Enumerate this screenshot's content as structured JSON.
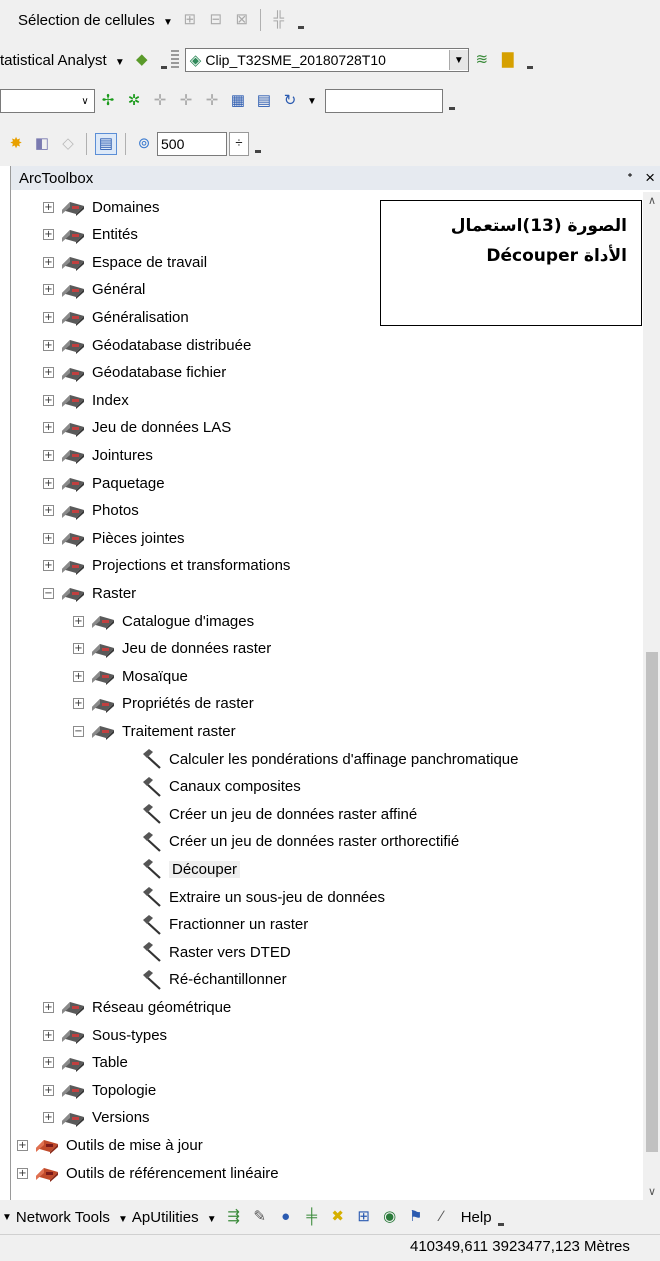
{
  "toolbars": {
    "row1": {
      "label": "Sélection de cellules"
    },
    "row2": {
      "label": "tatistical Analyst",
      "layer_combo": "Clip_T32SME_20180728T10"
    },
    "row4": {
      "scale_value": "500"
    }
  },
  "panel": {
    "title": "ArcToolbox",
    "pin": "ᐩ",
    "close": "×"
  },
  "tree": [
    {
      "label": "Domaines",
      "level": 2,
      "kind": "toolbox",
      "state": "collapsed"
    },
    {
      "label": "Entités",
      "level": 2,
      "kind": "toolbox",
      "state": "collapsed"
    },
    {
      "label": "Espace de travail",
      "level": 2,
      "kind": "toolbox",
      "state": "collapsed"
    },
    {
      "label": "Général",
      "level": 2,
      "kind": "toolbox",
      "state": "collapsed"
    },
    {
      "label": "Généralisation",
      "level": 2,
      "kind": "toolbox",
      "state": "collapsed"
    },
    {
      "label": "Géodatabase distribuée",
      "level": 2,
      "kind": "toolbox",
      "state": "collapsed"
    },
    {
      "label": "Géodatabase fichier",
      "level": 2,
      "kind": "toolbox",
      "state": "collapsed"
    },
    {
      "label": "Index",
      "level": 2,
      "kind": "toolbox",
      "state": "collapsed"
    },
    {
      "label": "Jeu de données LAS",
      "level": 2,
      "kind": "toolbox",
      "state": "collapsed"
    },
    {
      "label": "Jointures",
      "level": 2,
      "kind": "toolbox",
      "state": "collapsed"
    },
    {
      "label": "Paquetage",
      "level": 2,
      "kind": "toolbox",
      "state": "collapsed"
    },
    {
      "label": "Photos",
      "level": 2,
      "kind": "toolbox",
      "state": "collapsed"
    },
    {
      "label": "Pièces jointes",
      "level": 2,
      "kind": "toolbox",
      "state": "collapsed"
    },
    {
      "label": "Projections et transformations",
      "level": 2,
      "kind": "toolbox",
      "state": "collapsed"
    },
    {
      "label": "Raster",
      "level": 2,
      "kind": "toolbox",
      "state": "expanded"
    },
    {
      "label": "Catalogue d'images",
      "level": 3,
      "kind": "toolbox",
      "state": "collapsed"
    },
    {
      "label": "Jeu de données raster",
      "level": 3,
      "kind": "toolbox",
      "state": "collapsed"
    },
    {
      "label": "Mosaïque",
      "level": 3,
      "kind": "toolbox",
      "state": "collapsed"
    },
    {
      "label": "Propriétés de raster",
      "level": 3,
      "kind": "toolbox",
      "state": "collapsed"
    },
    {
      "label": "Traitement raster",
      "level": 3,
      "kind": "toolbox",
      "state": "expanded"
    },
    {
      "label": "Calculer les pondérations d'affinage panchromatique",
      "level": 4,
      "kind": "tool"
    },
    {
      "label": "Canaux composites",
      "level": 4,
      "kind": "tool"
    },
    {
      "label": "Créer un jeu de données raster affiné",
      "level": 4,
      "kind": "tool"
    },
    {
      "label": "Créer un jeu de données raster orthorectifié",
      "level": 4,
      "kind": "tool"
    },
    {
      "label": "Découper",
      "level": 4,
      "kind": "tool",
      "highlighted": true
    },
    {
      "label": "Extraire un sous-jeu de données",
      "level": 4,
      "kind": "tool"
    },
    {
      "label": "Fractionner un raster",
      "level": 4,
      "kind": "tool"
    },
    {
      "label": "Raster vers DTED",
      "level": 4,
      "kind": "tool"
    },
    {
      "label": "Ré-échantillonner",
      "level": 4,
      "kind": "tool"
    },
    {
      "label": "Réseau géométrique",
      "level": 2,
      "kind": "toolbox",
      "state": "collapsed"
    },
    {
      "label": "Sous-types",
      "level": 2,
      "kind": "toolbox",
      "state": "collapsed"
    },
    {
      "label": "Table",
      "level": 2,
      "kind": "toolbox",
      "state": "collapsed"
    },
    {
      "label": "Topologie",
      "level": 2,
      "kind": "toolbox",
      "state": "collapsed"
    },
    {
      "label": "Versions",
      "level": 2,
      "kind": "toolbox",
      "state": "collapsed"
    },
    {
      "label": "Outils de mise à jour",
      "level": 1,
      "kind": "toolbox-red",
      "state": "collapsed"
    },
    {
      "label": "Outils de référencement linéaire",
      "level": 1,
      "kind": "toolbox-red",
      "state": "collapsed"
    }
  ],
  "annotation": {
    "line1": "الصورة (13)استعمال",
    "line2": "الأداة Découper"
  },
  "bottom_toolbar": {
    "network_tools": "Network Tools",
    "aputilities": "ApUtilities",
    "help": "Help"
  },
  "status_bar": {
    "coordinates": "410349,611  3923477,123 Mètres"
  }
}
